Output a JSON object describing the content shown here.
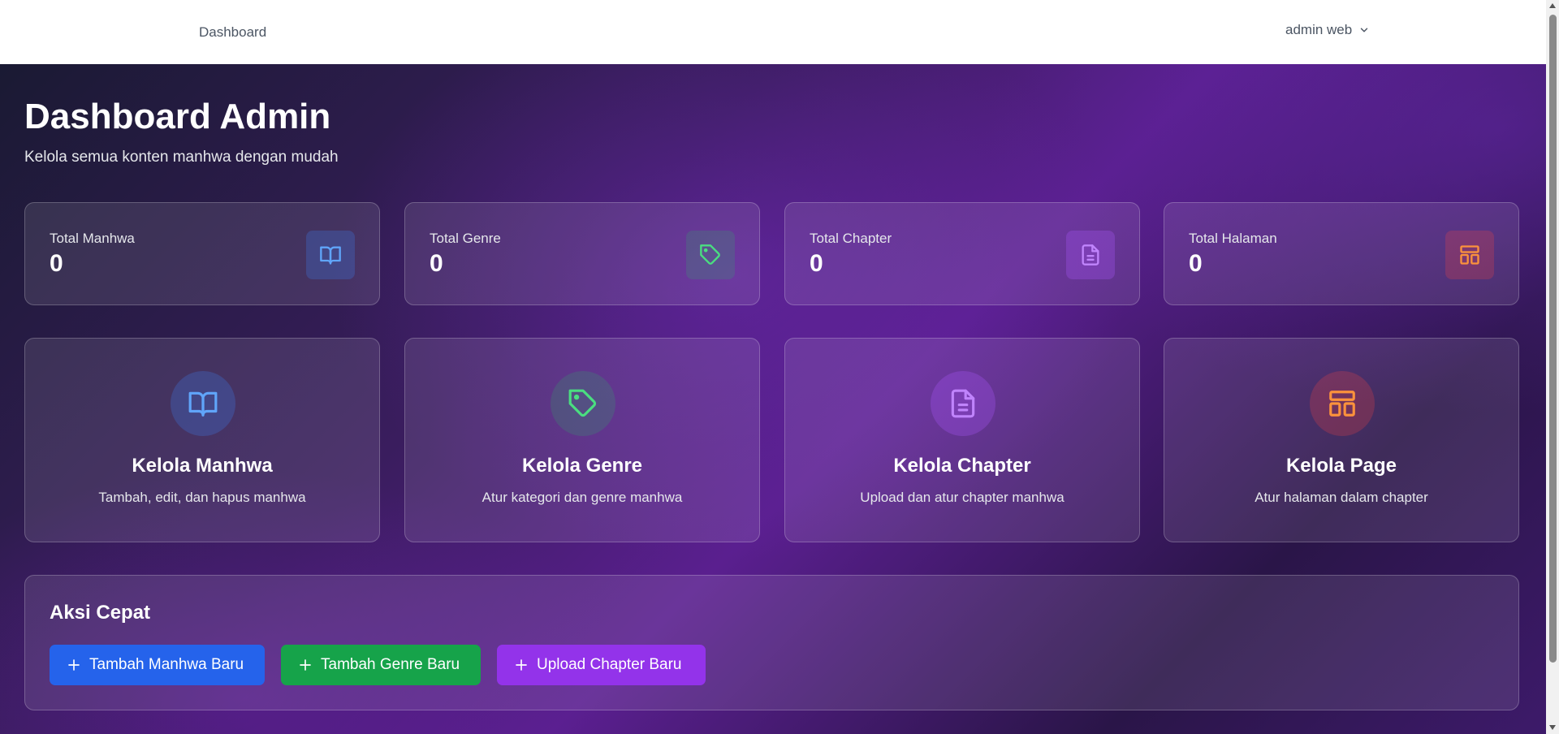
{
  "nav": {
    "dashboard_link": "Dashboard",
    "user_name": "admin web",
    "user_chevron_icon": "chevron-down-icon"
  },
  "header": {
    "title": "Dashboard Admin",
    "subtitle": "Kelola semua konten manhwa dengan mudah"
  },
  "stats": [
    {
      "label": "Total Manhwa",
      "value": "0",
      "icon": "book-open-icon",
      "color": "#60a5fa"
    },
    {
      "label": "Total Genre",
      "value": "0",
      "icon": "tag-icon",
      "color": "#4ade80"
    },
    {
      "label": "Total Chapter",
      "value": "0",
      "icon": "document-icon",
      "color": "#c084fc"
    },
    {
      "label": "Total Halaman",
      "value": "0",
      "icon": "layout-icon",
      "color": "#fb923c"
    }
  ],
  "manage": [
    {
      "title": "Kelola Manhwa",
      "desc": "Tambah, edit, dan hapus manhwa",
      "icon": "book-open-icon",
      "color": "#60a5fa"
    },
    {
      "title": "Kelola Genre",
      "desc": "Atur kategori dan genre manhwa",
      "icon": "tag-icon",
      "color": "#4ade80"
    },
    {
      "title": "Kelola Chapter",
      "desc": "Upload dan atur chapter manhwa",
      "icon": "document-icon",
      "color": "#c084fc"
    },
    {
      "title": "Kelola Page",
      "desc": "Atur halaman dalam chapter",
      "icon": "layout-icon",
      "color": "#fb923c"
    }
  ],
  "quick_actions": {
    "title": "Aksi Cepat",
    "buttons": [
      {
        "label": "Tambah Manhwa Baru",
        "color": "#2563eb",
        "icon": "plus-icon"
      },
      {
        "label": "Tambah Genre Baru",
        "color": "#16a34a",
        "icon": "plus-icon"
      },
      {
        "label": "Upload Chapter Baru",
        "color": "#9333ea",
        "icon": "plus-icon"
      }
    ]
  }
}
